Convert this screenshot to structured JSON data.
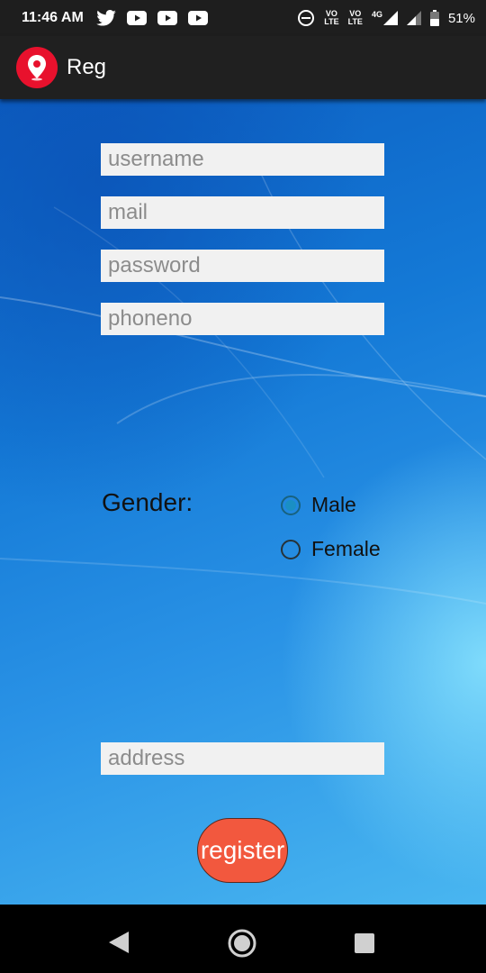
{
  "status_bar": {
    "time": "11:46 AM",
    "notification_icons": [
      "twitter-icon",
      "youtube-icon",
      "youtube-icon",
      "youtube-icon"
    ],
    "indicators": {
      "vo1": "VO",
      "lte1": "LTE",
      "vo2": "VO",
      "lte2": "LTE",
      "network": "4G"
    },
    "battery": "51%"
  },
  "app_bar": {
    "title": "Reg",
    "logo_color": "#e8112d"
  },
  "form": {
    "username_placeholder": "username",
    "mail_placeholder": "mail",
    "password_placeholder": "password",
    "phone_placeholder": "phoneno",
    "gender_label": "Gender:",
    "gender_options": [
      {
        "label": "Male",
        "selected": true
      },
      {
        "label": "Female",
        "selected": false
      }
    ],
    "address_placeholder": "address",
    "register_label": "register",
    "register_color": "#f2583e"
  },
  "nav_bar": {
    "icons": [
      "back-icon",
      "home-icon",
      "recents-icon"
    ]
  }
}
